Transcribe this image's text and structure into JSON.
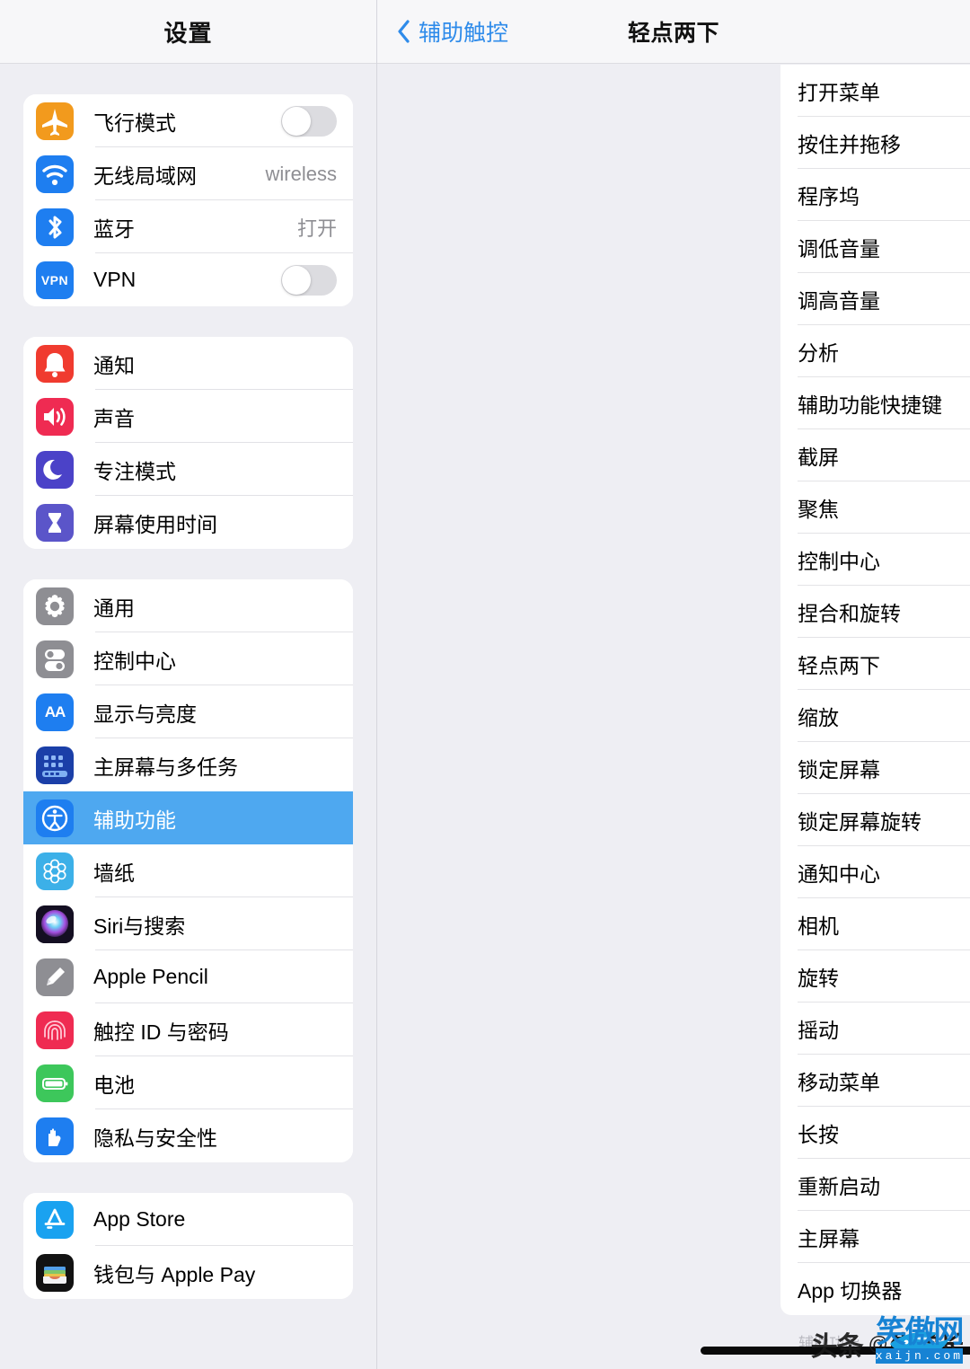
{
  "sidebar": {
    "title": "设置",
    "groups": [
      {
        "id": "connectivity",
        "rows": [
          {
            "label": "飞行模式",
            "icon": "airplane-icon",
            "icon_bg": "#f29a1d",
            "accessory": "toggle",
            "toggle_on": false
          },
          {
            "label": "无线局域网",
            "icon": "wifi-icon",
            "icon_bg": "#1e7ef0",
            "accessory": "value",
            "value": "wireless"
          },
          {
            "label": "蓝牙",
            "icon": "bluetooth-icon",
            "icon_bg": "#1e7ef0",
            "accessory": "value",
            "value": "打开"
          },
          {
            "label": "VPN",
            "icon": "vpn-icon",
            "icon_bg": "#1e7ef0",
            "accessory": "toggle",
            "toggle_on": false
          }
        ]
      },
      {
        "id": "alerts",
        "rows": [
          {
            "label": "通知",
            "icon": "bell-icon",
            "icon_bg": "#f03b2f",
            "accessory": "none"
          },
          {
            "label": "声音",
            "icon": "speaker-icon",
            "icon_bg": "#ef2b52",
            "accessory": "none"
          },
          {
            "label": "专注模式",
            "icon": "moon-icon",
            "icon_bg": "#4b42c8",
            "accessory": "none"
          },
          {
            "label": "屏幕使用时间",
            "icon": "hourglass-icon",
            "icon_bg": "#5b55c9",
            "accessory": "none"
          }
        ]
      },
      {
        "id": "system",
        "rows": [
          {
            "label": "通用",
            "icon": "gear-icon",
            "icon_bg": "#8e8e93",
            "accessory": "none"
          },
          {
            "label": "控制中心",
            "icon": "sliders-icon",
            "icon_bg": "#8e8e93",
            "accessory": "none"
          },
          {
            "label": "显示与亮度",
            "icon": "text-size-icon",
            "icon_bg": "#1e7ef0",
            "accessory": "none"
          },
          {
            "label": "主屏幕与多任务",
            "icon": "home-grid-icon",
            "icon_bg": "#1b3fa8",
            "accessory": "none"
          },
          {
            "label": "辅助功能",
            "icon": "accessibility-icon",
            "icon_bg": "#1e7ef0",
            "accessory": "none",
            "selected": true
          },
          {
            "label": "墙纸",
            "icon": "wallpaper-icon",
            "icon_bg": "#3cb0e8",
            "accessory": "none"
          },
          {
            "label": "Siri与搜索",
            "icon": "siri-icon",
            "icon_bg": "#1b1b2b",
            "accessory": "none"
          },
          {
            "label": "Apple Pencil",
            "icon": "pencil-icon",
            "icon_bg": "#8e8e93",
            "accessory": "none"
          },
          {
            "label": "触控 ID 与密码",
            "icon": "touchid-icon",
            "icon_bg": "#ef2b52",
            "accessory": "none"
          },
          {
            "label": "电池",
            "icon": "battery-icon",
            "icon_bg": "#3dc75b",
            "accessory": "none"
          },
          {
            "label": "隐私与安全性",
            "icon": "hand-privacy-icon",
            "icon_bg": "#1e7ef0",
            "accessory": "none"
          }
        ]
      },
      {
        "id": "services",
        "rows": [
          {
            "label": "App Store",
            "icon": "appstore-icon",
            "icon_bg": "#1aa2f0",
            "accessory": "none"
          },
          {
            "label": "钱包与 Apple Pay",
            "icon": "wallet-icon",
            "icon_bg": "#121212",
            "accessory": "none"
          }
        ]
      }
    ]
  },
  "detail": {
    "back_label": "辅助触控",
    "title": "轻点两下",
    "check_color": "#3a9ae8",
    "footer_ghost_label": "辅助功能",
    "rows": [
      {
        "label": "打开菜单",
        "checked": false
      },
      {
        "label": "按住并拖移",
        "checked": false
      },
      {
        "label": "程序坞",
        "checked": false
      },
      {
        "label": "调低音量",
        "checked": false
      },
      {
        "label": "调高音量",
        "checked": false
      },
      {
        "label": "分析",
        "checked": false
      },
      {
        "label": "辅助功能快捷键",
        "checked": false
      },
      {
        "label": "截屏",
        "checked": true
      },
      {
        "label": "聚焦",
        "checked": false
      },
      {
        "label": "控制中心",
        "checked": false
      },
      {
        "label": "捏合和旋转",
        "checked": false
      },
      {
        "label": "轻点两下",
        "checked": false
      },
      {
        "label": "缩放",
        "checked": false
      },
      {
        "label": "锁定屏幕",
        "checked": false
      },
      {
        "label": "锁定屏幕旋转",
        "checked": false
      },
      {
        "label": "通知中心",
        "checked": false
      },
      {
        "label": "相机",
        "checked": false
      },
      {
        "label": "旋转",
        "checked": false
      },
      {
        "label": "摇动",
        "checked": false
      },
      {
        "label": "移动菜单",
        "checked": false
      },
      {
        "label": "长按",
        "checked": false
      },
      {
        "label": "重新启动",
        "checked": false
      },
      {
        "label": "主屏幕",
        "checked": false
      },
      {
        "label": "App 切换器",
        "checked": false
      }
    ]
  },
  "watermark": {
    "platform": "头条",
    "at": "@",
    "author": "牛学长",
    "brand": "笑傲网",
    "brand_box_char": "网",
    "url": "xaijn.com"
  }
}
